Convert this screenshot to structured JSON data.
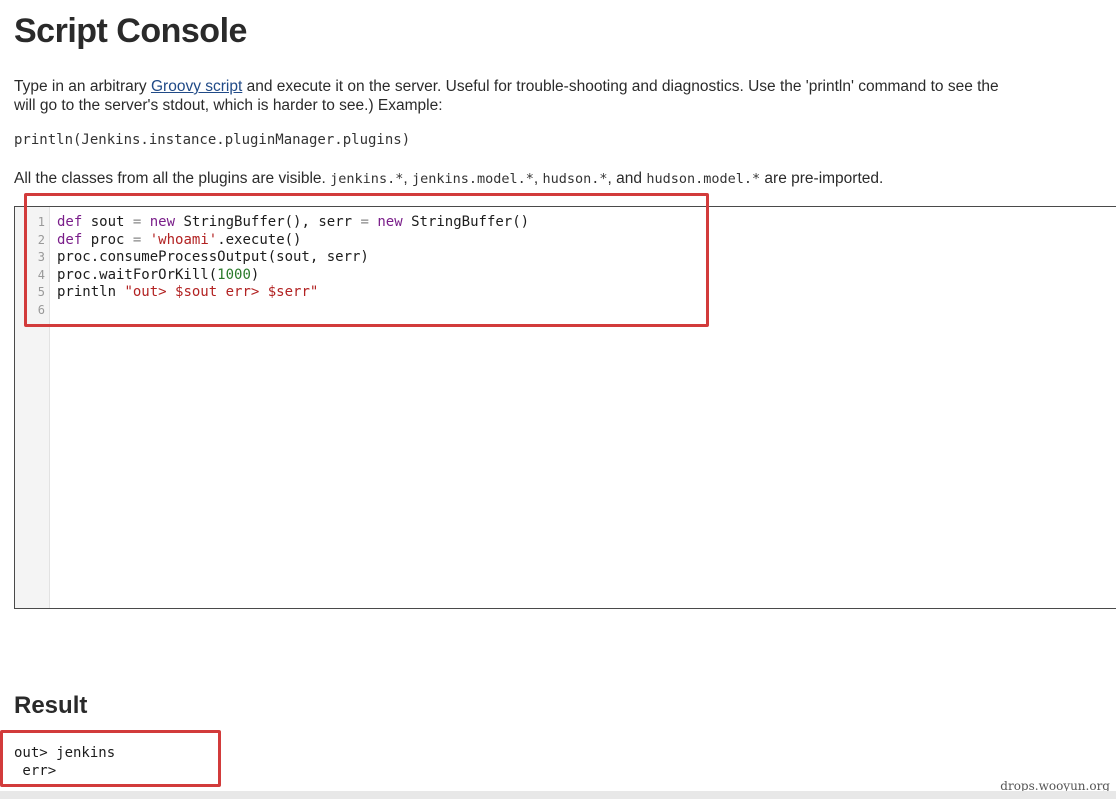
{
  "page": {
    "title": "Script Console"
  },
  "intro": {
    "line1_before": "Type in an arbitrary ",
    "link_text": "Groovy script",
    "line1_after": " and execute it on the server. Useful for trouble-shooting and diagnostics. Use the 'println' command to see the",
    "line2": "will go to the server's stdout, which is harder to see.) Example:"
  },
  "example_code": "println(Jenkins.instance.pluginManager.plugins)",
  "classes_note": {
    "prefix": "All the classes from all the plugins are visible. ",
    "c1": "jenkins.*",
    "sep1": ", ",
    "c2": "jenkins.model.*",
    "sep2": ", ",
    "c3": "hudson.*",
    "sep3": ", and ",
    "c4": "hudson.model.*",
    "suffix": " are pre-imported."
  },
  "editor": {
    "line_numbers": [
      "1",
      "2",
      "3",
      "4",
      "5",
      "6"
    ],
    "lines": [
      [
        {
          "t": "def",
          "c": "kw"
        },
        {
          "t": " sout ",
          "c": ""
        },
        {
          "t": "=",
          "c": "op"
        },
        {
          "t": " ",
          "c": ""
        },
        {
          "t": "new",
          "c": "kw"
        },
        {
          "t": " StringBuffer(), serr ",
          "c": ""
        },
        {
          "t": "=",
          "c": "op"
        },
        {
          "t": " ",
          "c": ""
        },
        {
          "t": "new",
          "c": "kw"
        },
        {
          "t": " StringBuffer()",
          "c": ""
        }
      ],
      [
        {
          "t": "def",
          "c": "kw"
        },
        {
          "t": " proc ",
          "c": ""
        },
        {
          "t": "=",
          "c": "op"
        },
        {
          "t": " ",
          "c": ""
        },
        {
          "t": "'whoami'",
          "c": "str"
        },
        {
          "t": ".execute()",
          "c": ""
        }
      ],
      [
        {
          "t": "proc.consumeProcessOutput(sout, serr)",
          "c": ""
        }
      ],
      [
        {
          "t": "proc.waitForOrKill(",
          "c": ""
        },
        {
          "t": "1000",
          "c": "num"
        },
        {
          "t": ")",
          "c": ""
        }
      ],
      [
        {
          "t": "println ",
          "c": ""
        },
        {
          "t": "\"out> $sout err> $serr\"",
          "c": "str"
        }
      ],
      []
    ]
  },
  "result": {
    "heading": "Result",
    "output": "out> jenkins\n err>"
  },
  "watermark": "drops.wooyun.org",
  "colors": {
    "highlight_border": "#d23b3b",
    "keyword": "#7a1e8a",
    "string": "#b22222",
    "number": "#2a7a2a",
    "link": "#204a87"
  }
}
